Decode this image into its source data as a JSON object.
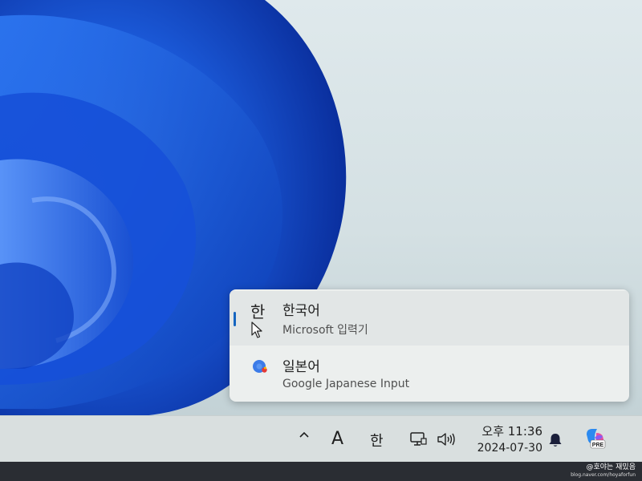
{
  "ime_menu": {
    "items": [
      {
        "glyph": "한",
        "title": "한국어",
        "subtitle": "Microsoft 입력기",
        "selected": true
      },
      {
        "glyph": "google-ime-icon",
        "title": "일본어",
        "subtitle": "Google Japanese Input",
        "selected": false
      }
    ]
  },
  "taskbar": {
    "chevron": "^",
    "ime_mode": "A",
    "ime_lang": "한",
    "clock": {
      "time": "오후 11:36",
      "date": "2024-07-30"
    }
  },
  "watermark": {
    "name": "@호야는 재밌음",
    "url": "blog.naver.com/hoyaforfun"
  },
  "colors": {
    "accent": "#1565c0",
    "wallpaper_blue": "#1e5bd6"
  }
}
